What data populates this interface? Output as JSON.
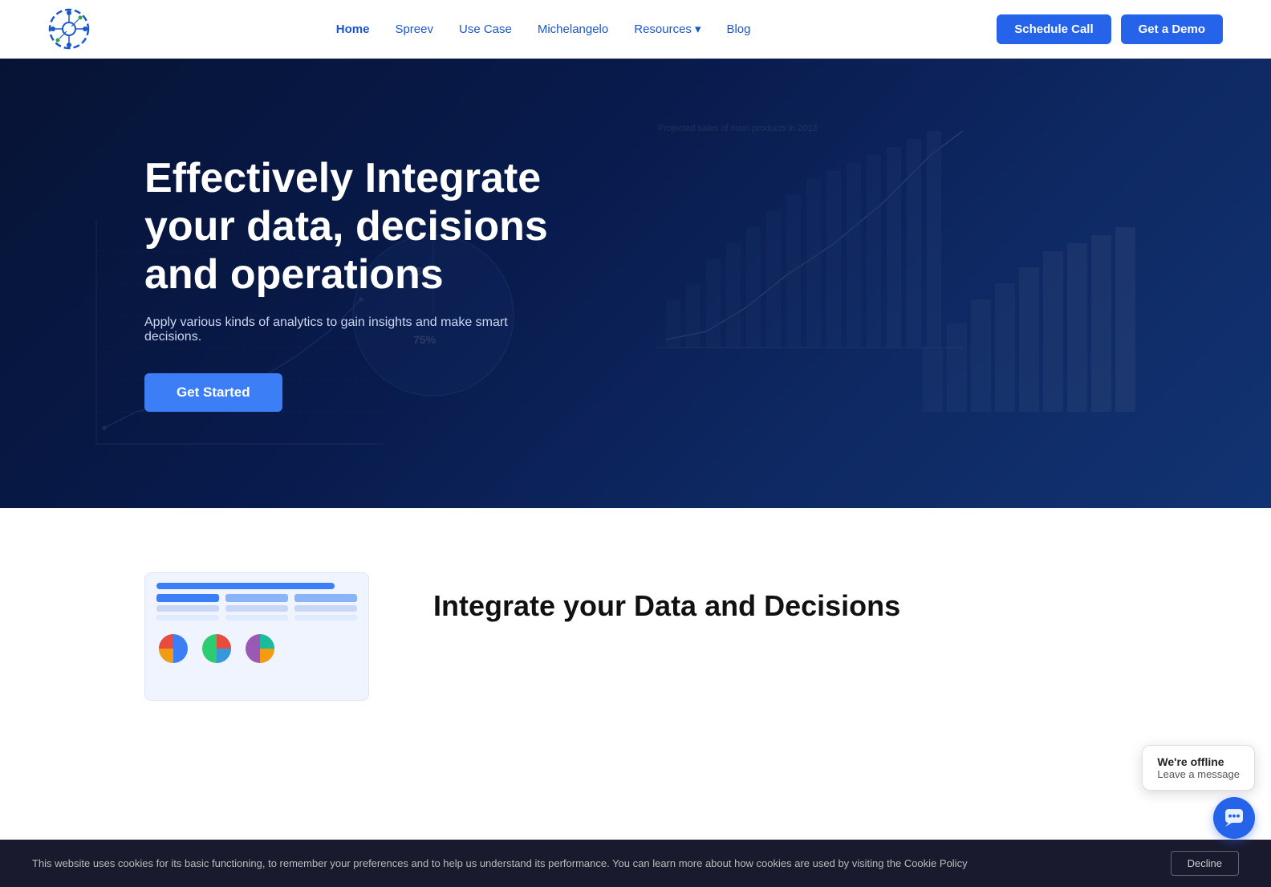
{
  "nav": {
    "links": [
      {
        "label": "Home",
        "active": true
      },
      {
        "label": "Spreev",
        "active": false
      },
      {
        "label": "Use Case",
        "active": false
      },
      {
        "label": "Michelangelo",
        "active": false
      },
      {
        "label": "Resources",
        "active": false,
        "hasDropdown": true
      },
      {
        "label": "Blog",
        "active": false
      }
    ],
    "schedule_label": "Schedule Call",
    "demo_label": "Get a Demo"
  },
  "hero": {
    "title": "Effectively Integrate your data, decisions and operations",
    "subtitle": "Apply various kinds of analytics to gain insights and make smart decisions.",
    "cta_label": "Get Started"
  },
  "section": {
    "title": "Integrate your Data and Decisions"
  },
  "cookie": {
    "text": "This website uses cookies for its basic functioning, to remember your preferences and to help us understand its performance. You can learn more about how cookies are used by visiting the Cookie Policy",
    "cookie_policy_label": "Cookie Policy",
    "decline_label": "Decline"
  },
  "chat": {
    "offline_label": "We're offline",
    "leave_label": "Leave a message"
  },
  "icons": {
    "chevron_down": "▾",
    "chat_icon": "💬"
  }
}
